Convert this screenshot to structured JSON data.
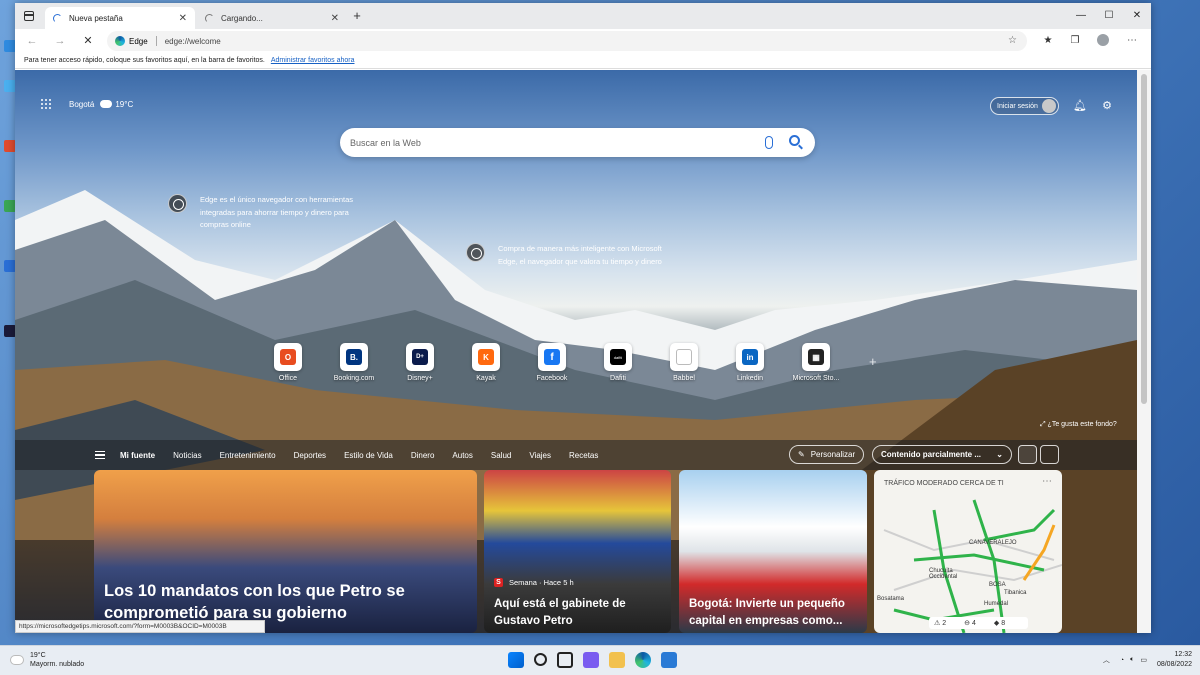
{
  "browser": {
    "tabs": [
      {
        "title": "Nueva pestaña",
        "active": true
      },
      {
        "title": "Cargando...",
        "active": false
      }
    ],
    "new_tab_symbol": "+",
    "window_controls": [
      "—",
      "☐",
      "✕"
    ],
    "address": {
      "site_label": "Edge",
      "url": "edge://welcome"
    },
    "favorites_bar": {
      "text": "Para tener acceso rápido, coloque sus favoritos aquí, en la barra de favoritos.",
      "link": "Administrar favoritos ahora"
    },
    "status_url": "https://microsoftedgetips.microsoft.com/?form=M0003B&OCID=M0003B"
  },
  "newtab": {
    "location": "Bogotá",
    "temperature": "19°C",
    "signin_label": "Iniciar sesión",
    "search_placeholder": "Buscar en la Web",
    "hotspots": [
      {
        "text": "Edge es el único navegador con herramientas integradas para ahorrar tiempo y dinero para compras online"
      },
      {
        "text": "Compra de manera más inteligente con Microsoft Edge, el navegador que valora tu tiempo y dinero"
      }
    ],
    "quick_links": [
      {
        "label": "Office",
        "icon": "office-icon",
        "color": "#e84c1f",
        "glyph": "O"
      },
      {
        "label": "Booking.com",
        "icon": "booking-icon",
        "color": "#003580",
        "glyph": "B."
      },
      {
        "label": "Disney+",
        "icon": "disney-icon",
        "color": "#0b1b4c",
        "glyph": "D+"
      },
      {
        "label": "Kayak",
        "icon": "kayak-icon",
        "color": "#ff690f",
        "glyph": "K"
      },
      {
        "label": "Facebook",
        "icon": "facebook-icon",
        "color": "#1877f2",
        "glyph": "f"
      },
      {
        "label": "Dafiti",
        "icon": "dafiti-icon",
        "color": "#000000",
        "glyph": "dafiti"
      },
      {
        "label": "Babbel",
        "icon": "babbel-icon",
        "color": "#cccccc",
        "glyph": ""
      },
      {
        "label": "Linkedin",
        "icon": "linkedin-icon",
        "color": "#0a66c2",
        "glyph": "in"
      },
      {
        "label": "Microsoft Sto...",
        "icon": "store-icon",
        "color": "#222222",
        "glyph": "▦"
      }
    ],
    "background_question": "¿Te gusta este fondo?",
    "feed_tabs": [
      "Mi fuente",
      "Noticias",
      "Entretenimiento",
      "Deportes",
      "Estilo de Vida",
      "Dinero",
      "Autos",
      "Salud",
      "Viajes",
      "Recetas"
    ],
    "personalize_label": "Personalizar",
    "content_select": "Contenido parcialmente ...",
    "cards": [
      {
        "headline": "Los 10 mandatos con los que Petro se comprometió para su gobierno"
      },
      {
        "source": "Semana · Hace 5 h",
        "headline": "Aquí está el gabinete de Gustavo Petro"
      },
      {
        "headline": "Bogotá: Invierte un pequeño capital en empresas como..."
      }
    ],
    "traffic_card": {
      "title": "TRÁFICO MODERADO CERCA DE TI",
      "labels": [
        "CANAVERALEJO",
        "Chucuita Occidental",
        "BOSA",
        "Humedal",
        "Bosatama",
        "Tibanica"
      ],
      "stats": [
        "2",
        "4",
        "8"
      ]
    }
  },
  "taskbar": {
    "weather_temp": "19°C",
    "weather_desc": "Mayorm. nublado",
    "time": "12:32",
    "date": "08/08/2022"
  }
}
